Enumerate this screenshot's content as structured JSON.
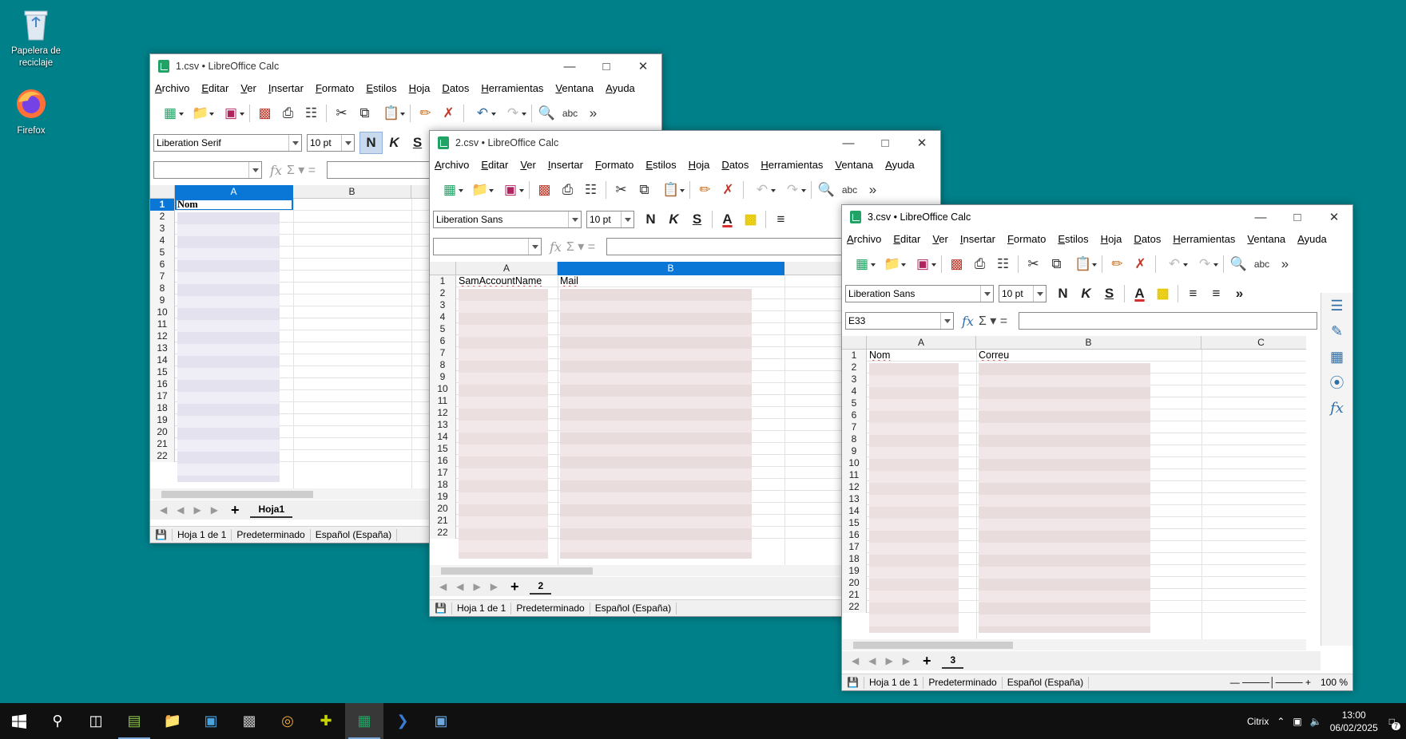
{
  "desktop": {
    "icons": [
      {
        "label": "Papelera de reciclaje",
        "icon": "recycle-bin-icon"
      },
      {
        "label": "Firefox",
        "icon": "firefox-icon"
      }
    ]
  },
  "menu": [
    "Archivo",
    "Editar",
    "Ver",
    "Insertar",
    "Formato",
    "Estilos",
    "Hoja",
    "Datos",
    "Herramientas",
    "Ventana",
    "Ayuda"
  ],
  "windows": [
    {
      "title": "1.csv • LibreOffice Calc",
      "font": "Liberation Serif",
      "size": "10 pt",
      "namebox": "",
      "columns": [
        "A",
        "B"
      ],
      "selected_column": "A",
      "headers": {
        "A": "Nom",
        "B": ""
      },
      "rows": [
        "1",
        "2",
        "3",
        "4",
        "5",
        "6",
        "7",
        "8",
        "9",
        "10",
        "11",
        "12",
        "13",
        "14",
        "15",
        "16",
        "17",
        "18",
        "19",
        "20",
        "21",
        "22"
      ],
      "sheet_tab": "Hoja1",
      "status": {
        "sheet": "Hoja 1 de 1",
        "style": "Predeterminado",
        "lang": "Español (España)"
      }
    },
    {
      "title": "2.csv • LibreOffice Calc",
      "font": "Liberation Sans",
      "size": "10 pt",
      "namebox": "",
      "columns": [
        "A",
        "B",
        "C"
      ],
      "selected_column": "B",
      "headers": {
        "A": "SamAccountName",
        "B": "Mail",
        "C": ""
      },
      "rows": [
        "1",
        "2",
        "3",
        "4",
        "5",
        "6",
        "7",
        "8",
        "9",
        "10",
        "11",
        "12",
        "13",
        "14",
        "15",
        "16",
        "17",
        "18",
        "19",
        "20",
        "21",
        "22"
      ],
      "sheet_tab": "2",
      "status": {
        "sheet": "Hoja 1 de 1",
        "style": "Predeterminado",
        "lang": "Español (España)"
      }
    },
    {
      "title": "3.csv • LibreOffice Calc",
      "font": "Liberation Sans",
      "size": "10 pt",
      "namebox": "E33",
      "columns": [
        "A",
        "B",
        "C"
      ],
      "selected_column": "",
      "headers": {
        "A": "Nom",
        "B": "Correu",
        "C": ""
      },
      "rows": [
        "1",
        "2",
        "3",
        "4",
        "5",
        "6",
        "7",
        "8",
        "9",
        "10",
        "11",
        "12",
        "13",
        "14",
        "15",
        "16",
        "17",
        "18",
        "19",
        "20",
        "21",
        "22"
      ],
      "sheet_tab": "3",
      "status": {
        "sheet": "Hoja 1 de 1",
        "style": "Predeterminado",
        "lang": "Español (España)",
        "zoom": "100 %"
      }
    }
  ],
  "format_buttons": {
    "bold": "N",
    "italic": "K",
    "underline": "S",
    "font_color": "A"
  },
  "taskbar": {
    "tray_label": "Citrix",
    "time": "13:00",
    "date": "06/02/2025",
    "notifications": "7"
  },
  "colors": {
    "desktop": "#00818a",
    "selection": "#0a76d6",
    "calc_green": "#21a366",
    "taskbar": "#101010"
  }
}
